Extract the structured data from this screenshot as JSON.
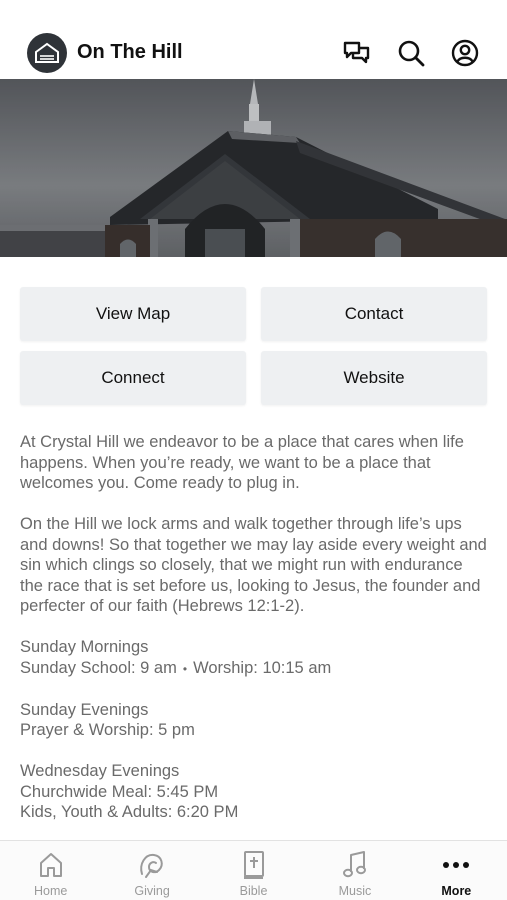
{
  "app": {
    "title": "On The Hill"
  },
  "header": {
    "icons": [
      "chat-icon",
      "search-icon",
      "profile-icon"
    ]
  },
  "actions": {
    "view_map": "View Map",
    "contact": "Contact",
    "connect": "Connect",
    "website": "Website"
  },
  "content": {
    "intro": "At Crystal Hill we endeavor to be a place that cares when life happens. When you’re ready, we want to be a place that welcomes you. Come ready to plug in.",
    "mission": "On the Hill we lock arms and walk together through life’s ups and downs! So that together we may lay aside every weight and sin which clings so closely, that we might run with endurance the race that is set before us, looking to Jesus, the founder and perfecter of our faith (Hebrews 12:1-2).",
    "sunday_mornings": {
      "heading": "Sunday Mornings",
      "school": "Sunday School: 9 am",
      "separator": "•",
      "worship": "Worship: 10:15 am"
    },
    "sunday_evenings": {
      "heading": "Sunday Evenings",
      "detail": "Prayer & Worship: 5 pm"
    },
    "wednesday_evenings": {
      "heading": "Wednesday Evenings",
      "meal": "Churchwide Meal: 5:45 PM",
      "kids": "Kids, Youth & Adults: 6:20 PM"
    }
  },
  "tabs": [
    {
      "label": "Home",
      "icon": "home-icon",
      "active": false
    },
    {
      "label": "Giving",
      "icon": "giving-icon",
      "active": false
    },
    {
      "label": "Bible",
      "icon": "bible-icon",
      "active": false
    },
    {
      "label": "Music",
      "icon": "music-icon",
      "active": false
    },
    {
      "label": "More",
      "icon": "more-icon",
      "active": true
    }
  ],
  "colors": {
    "accent_text": "#111111",
    "body_text": "#6a6a6a",
    "inactive_tab": "#9a9a9a",
    "button_bg": "#eef0f2"
  }
}
